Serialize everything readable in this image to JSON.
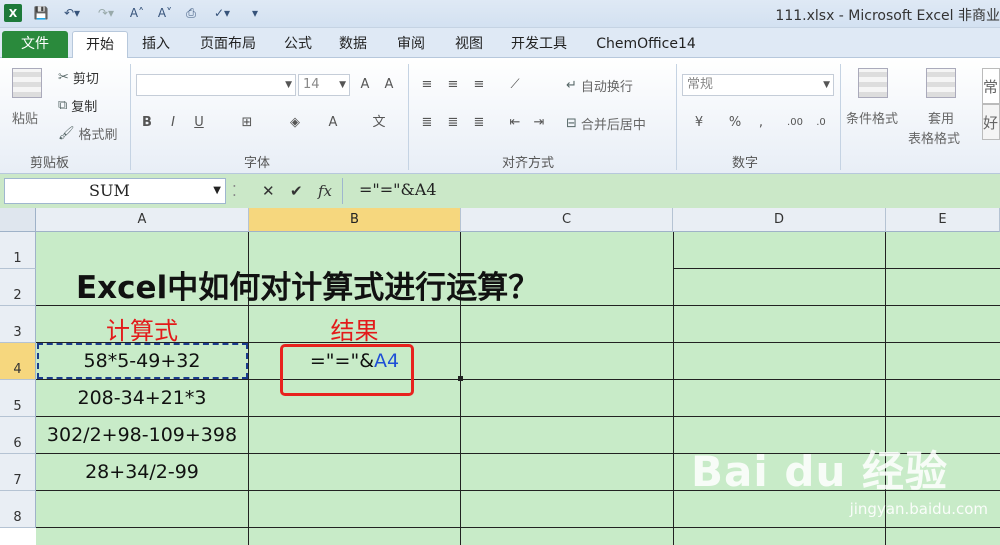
{
  "window": {
    "title": "111.xlsx - Microsoft Excel 非商业"
  },
  "qat": {
    "logo": "X"
  },
  "tabs": [
    "文件",
    "开始",
    "插入",
    "页面布局",
    "公式",
    "数据",
    "审阅",
    "视图",
    "开发工具",
    "ChemOffice14"
  ],
  "ribbon": {
    "clipboard": {
      "paste": "粘贴",
      "cut": "剪切",
      "copy": "复制",
      "format_painter": "格式刷",
      "label": "剪贴板"
    },
    "font": {
      "size": "14",
      "label": "字体",
      "bold": "B",
      "italic": "I",
      "underline": "U"
    },
    "alignment": {
      "wrap": "自动换行",
      "merge": "合并后居中",
      "label": "对齐方式"
    },
    "number": {
      "format": "常规",
      "percent": "%",
      "comma": ",",
      "label": "数字"
    },
    "styles": {
      "conditional": "条件格式",
      "table": "套用",
      "table2": "表格格式",
      "cell_style_1": "常",
      "cell_style_2": "好"
    }
  },
  "formula_bar": {
    "name_box": "SUM",
    "cancel": "✕",
    "enter": "✔",
    "fx": "fx",
    "formula": "=\"=\"&A4"
  },
  "columns": [
    "A",
    "B",
    "C",
    "D",
    "E"
  ],
  "rows": [
    "1",
    "2",
    "3",
    "4",
    "5",
    "6",
    "7",
    "8"
  ],
  "sheet": {
    "title": "Excel中如何对计算式进行运算？",
    "header_a": "计算式",
    "header_b": "结果",
    "a4": "58*5-49+32",
    "a5": "208-34+21*3",
    "a6": "302/2+98-109+398",
    "a7": "28+34/2-99",
    "b4_prefix": "=\"=\"&",
    "b4_ref": "A4"
  },
  "watermark": {
    "brand": "Bai du 经验",
    "url": "jingyan.baidu.com"
  },
  "colors": {
    "sheet_bg": "#c8ebc8",
    "file_tab": "#2a8a3c",
    "highlight": "#e8221e",
    "ref_blue": "#1f4fd6"
  }
}
